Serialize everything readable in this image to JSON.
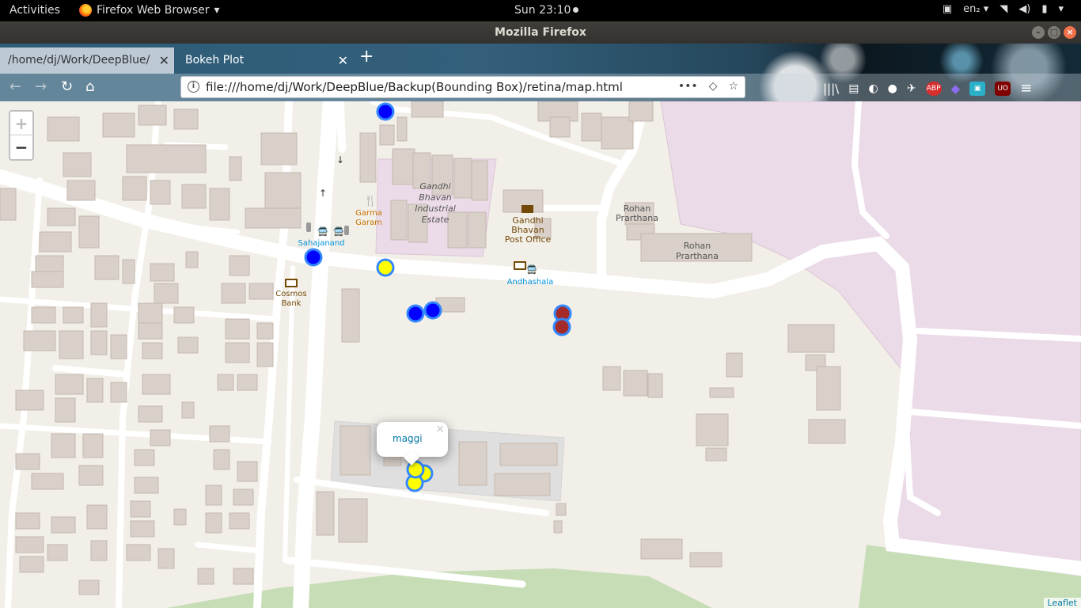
{
  "topbar": {
    "activities": "Activities",
    "app_menu": "Firefox Web Browser",
    "clock": "Sun 23:10",
    "keyboard": "en₂"
  },
  "window": {
    "title": "Mozilla Firefox"
  },
  "tabs": [
    {
      "label": "/home/dj/Work/DeepBlue/"
    },
    {
      "label": "Bokeh Plot"
    }
  ],
  "navbar": {
    "url": "file:///home/dj/Work/DeepBlue/Backup(Bounding Box)/retina/map.html",
    "page_actions": "•••"
  },
  "toolbar_icons": [
    {
      "icon": "adblock-plus-icon",
      "text": "ABP",
      "color": "#d72e2e"
    },
    {
      "icon": "ublock-origin-icon",
      "text": "UO",
      "color": "#800000"
    }
  ],
  "map": {
    "zoom_in": "+",
    "zoom_out": "−",
    "popup_text": "maggi",
    "attribution": "Leaflet",
    "labels": {
      "gandhi_estate_1": "Gandhi",
      "gandhi_estate_2": "Bhavan",
      "gandhi_estate_3": "Industrial",
      "gandhi_estate_4": "Estate",
      "post_office_1": "Gandhi",
      "post_office_2": "Bhavan",
      "post_office_3": "Post Office",
      "rohan_a_1": "Rohan",
      "rohan_a_2": "Prarthana",
      "rohan_b_1": "Rohan",
      "rohan_b_2": "Prarthana",
      "garma_1": "Garma",
      "garma_2": "Garam",
      "sahajanand": "Sahajanand",
      "cosmos_1": "Cosmos",
      "cosmos_2": "Bank",
      "andhashala": "Andhashala"
    },
    "marker_colors": {
      "blue": "#0000ff",
      "yellow": "#ffff00",
      "red": "#a52a2a",
      "outline": "#3388ff"
    }
  }
}
